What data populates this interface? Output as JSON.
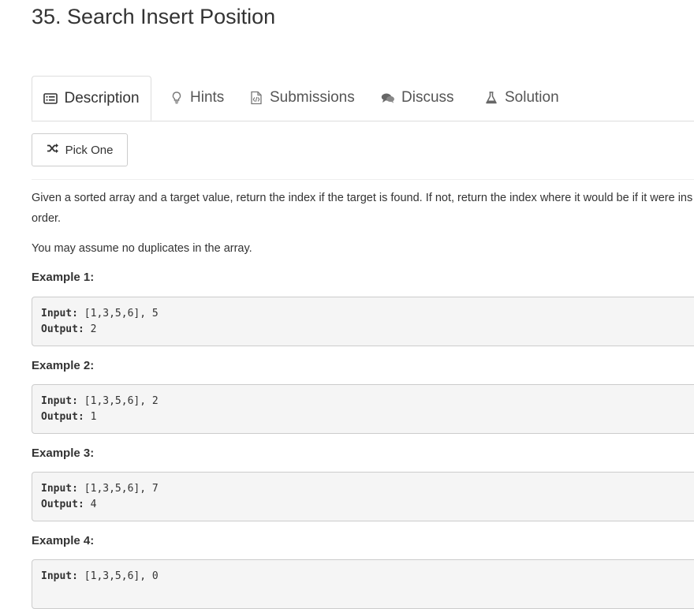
{
  "problem": {
    "title": "35. Search Insert Position"
  },
  "tabs": [
    {
      "label": "Description",
      "icon": "list-icon",
      "active": true
    },
    {
      "label": "Hints",
      "icon": "lightbulb-icon",
      "active": false
    },
    {
      "label": "Submissions",
      "icon": "code-file-icon",
      "active": false
    },
    {
      "label": "Discuss",
      "icon": "comments-icon",
      "active": false
    },
    {
      "label": "Solution",
      "icon": "flask-icon",
      "active": false
    }
  ],
  "pick_button": {
    "label": "Pick One",
    "icon": "shuffle-icon"
  },
  "description": {
    "line1": "Given a sorted array and a target value, return the index if the target is found. If not, return the index where it would be if it were ins",
    "line2": "order.",
    "note": "You may assume no duplicates in the array."
  },
  "examples": [
    {
      "heading": "Example 1:",
      "input_label": "Input:",
      "input": " [1,3,5,6], 5",
      "output_label": "Output:",
      "output": " 2"
    },
    {
      "heading": "Example 2:",
      "input_label": "Input:",
      "input": " [1,3,5,6], 2",
      "output_label": "Output:",
      "output": " 1"
    },
    {
      "heading": "Example 3:",
      "input_label": "Input:",
      "input": " [1,3,5,6], 7",
      "output_label": "Output:",
      "output": " 4"
    },
    {
      "heading": "Example 4:",
      "input_label": "Input:",
      "input": " [1,3,5,6], 0"
    }
  ],
  "colors": {
    "text": "#333333",
    "tab_text": "#555555",
    "border": "#dddddd",
    "code_bg": "#f5f5f5"
  }
}
